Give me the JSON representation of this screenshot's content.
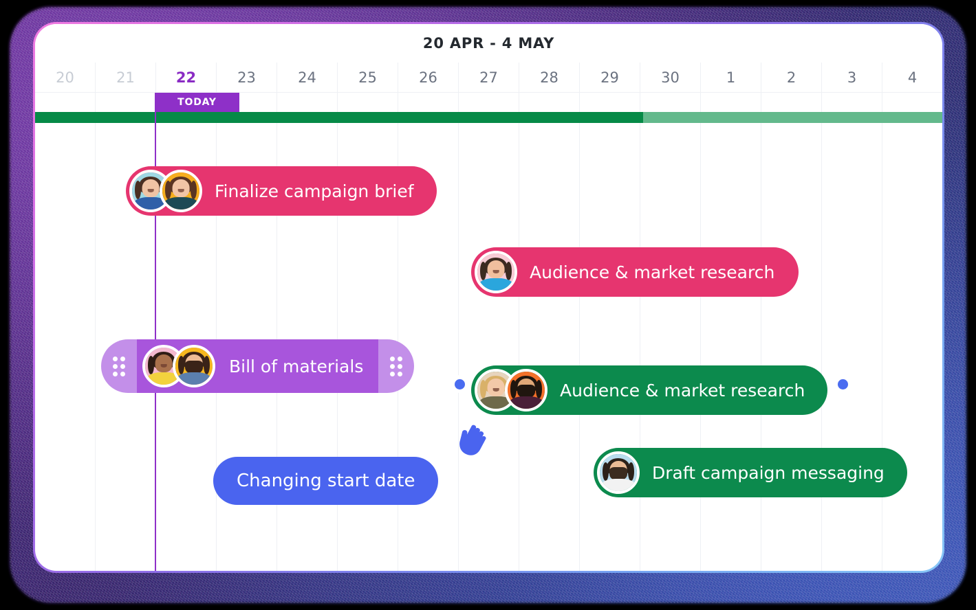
{
  "header": {
    "date_range_title": "20 APR - 4 MAY"
  },
  "timeline": {
    "days": [
      {
        "label": "20",
        "state": "past"
      },
      {
        "label": "21",
        "state": "past"
      },
      {
        "label": "22",
        "state": "today"
      },
      {
        "label": "23",
        "state": "future"
      },
      {
        "label": "24",
        "state": "future"
      },
      {
        "label": "25",
        "state": "future"
      },
      {
        "label": "26",
        "state": "future"
      },
      {
        "label": "27",
        "state": "future"
      },
      {
        "label": "28",
        "state": "future"
      },
      {
        "label": "29",
        "state": "future"
      },
      {
        "label": "30",
        "state": "future"
      },
      {
        "label": "1",
        "state": "future"
      },
      {
        "label": "2",
        "state": "future"
      },
      {
        "label": "3",
        "state": "future"
      },
      {
        "label": "4",
        "state": "future"
      }
    ],
    "today_label": "TODAY",
    "progress_complete_percent": 67
  },
  "tasks": [
    {
      "id": "finalize-campaign-brief",
      "label": "Finalize campaign brief",
      "color": "#e6356f",
      "assignees": [
        "avatar-woman-teal",
        "avatar-woman-orange"
      ]
    },
    {
      "id": "audience-market-research-pink",
      "label": "Audience & market research",
      "color": "#e6356f",
      "assignees": [
        "avatar-man-blue-shirt"
      ]
    },
    {
      "id": "bill-of-materials",
      "label": "Bill of materials",
      "color": "#a855dc",
      "cap_color": "#c38fe9",
      "assignees": [
        "avatar-woman-pink",
        "avatar-man-yellow"
      ],
      "editing": true
    },
    {
      "id": "audience-market-research-green",
      "label": "Audience & market research",
      "color": "#0c8a4d",
      "assignees": [
        "avatar-woman-blonde",
        "avatar-man-orange"
      ]
    },
    {
      "id": "draft-campaign-messaging",
      "label": "Draft campaign messaging",
      "color": "#0c8a4d",
      "assignees": [
        "avatar-man-white-shirt"
      ]
    }
  ],
  "interaction": {
    "tooltip_text": "Changing start date",
    "tooltip_color": "#4a64ef",
    "cursor_color": "#4a64ef",
    "dependency_dot_color": "#4a6cf0"
  },
  "colors": {
    "today_purple": "#8e30c8",
    "progress_done": "#068a47",
    "progress_remaining": "#63b98c",
    "pink": "#e6356f",
    "green": "#0c8a4d",
    "purple": "#a855dc",
    "blue": "#4a64ef",
    "grid_line": "#eef0f4",
    "day_text": "#6b7280",
    "day_text_past": "#c7ccd4"
  }
}
